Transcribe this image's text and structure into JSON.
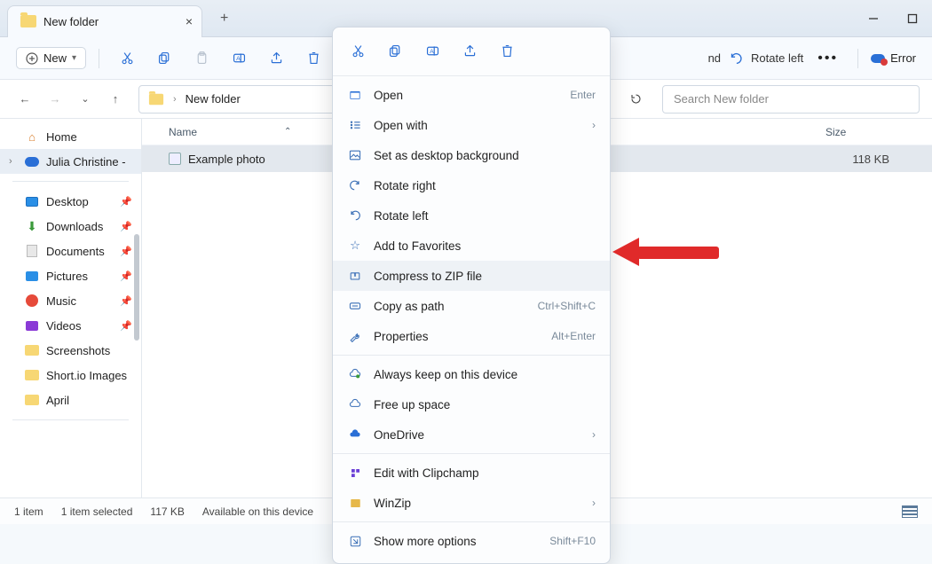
{
  "tab": {
    "title": "New folder"
  },
  "toolbar": {
    "new_label": "New",
    "rotate_partial": "nd",
    "rotate_left": "Rotate left",
    "error_label": "Error"
  },
  "nav": {
    "location": "New folder",
    "search_placeholder": "Search New folder"
  },
  "sidebar": {
    "home": "Home",
    "user": "Julia Christine - ",
    "items": [
      {
        "label": "Desktop"
      },
      {
        "label": "Downloads"
      },
      {
        "label": "Documents"
      },
      {
        "label": "Pictures"
      },
      {
        "label": "Music"
      },
      {
        "label": "Videos"
      },
      {
        "label": "Screenshots"
      },
      {
        "label": "Short.io Images"
      },
      {
        "label": "April"
      }
    ]
  },
  "columns": {
    "name": "Name",
    "size": "Size"
  },
  "files": [
    {
      "name": "Example photo",
      "size": "118 KB"
    }
  ],
  "status": {
    "count": "1 item",
    "selected": "1 item selected",
    "size": "117 KB",
    "avail": "Available on this device"
  },
  "ctx": {
    "open": "Open",
    "open_k": "Enter",
    "openwith": "Open with",
    "setbg": "Set as desktop background",
    "rotr": "Rotate right",
    "rotl": "Rotate left",
    "fav": "Add to Favorites",
    "zip": "Compress to ZIP file",
    "copypath": "Copy as path",
    "copypath_k": "Ctrl+Shift+C",
    "props": "Properties",
    "props_k": "Alt+Enter",
    "keep": "Always keep on this device",
    "free": "Free up space",
    "onedrive": "OneDrive",
    "clip": "Edit with Clipchamp",
    "winzip": "WinZip",
    "more": "Show more options",
    "more_k": "Shift+F10"
  }
}
